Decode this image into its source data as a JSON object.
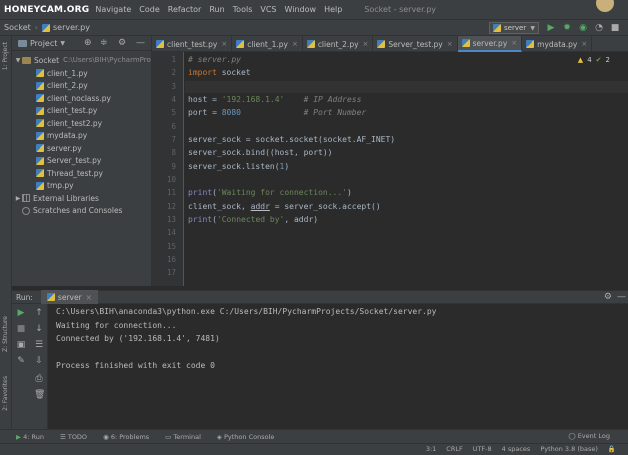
{
  "watermark": "HONEYCAM.ORG",
  "menu": [
    "Navigate",
    "Code",
    "Refactor",
    "Run",
    "Tools",
    "VCS",
    "Window",
    "Help"
  ],
  "window_title": "Socket - server.py",
  "breadcrumb": {
    "project": "Socket",
    "file": "server.py"
  },
  "run_config": {
    "name": "server"
  },
  "left_strip": {
    "project_label": "1: Project",
    "structure_label": "Z: Structure",
    "favorites_label": "2: Favorites"
  },
  "project_panel": {
    "title": "Project",
    "root": {
      "name": "Socket",
      "path": "C:\\Users\\BIH\\PycharmPro"
    },
    "files": [
      "client_1.py",
      "client_2.py",
      "client_noclass.py",
      "client_test.py",
      "client_test2.py",
      "mydata.py",
      "server.py",
      "Server_test.py",
      "Thread_test.py",
      "tmp.py"
    ],
    "external_libraries": "External Libraries",
    "scratches": "Scratches and Consoles"
  },
  "tabs": [
    {
      "label": "client_test.py",
      "active": false
    },
    {
      "label": "client_1.py",
      "active": false
    },
    {
      "label": "client_2.py",
      "active": false
    },
    {
      "label": "Server_test.py",
      "active": false
    },
    {
      "label": "server.py",
      "active": true
    },
    {
      "label": "mydata.py",
      "active": false
    }
  ],
  "editor": {
    "inspections": {
      "warnings": "4",
      "weak_warnings": "2"
    },
    "line_numbers": [
      "1",
      "2",
      "3",
      "4",
      "5",
      "6",
      "7",
      "8",
      "9",
      "10",
      "11",
      "12",
      "13",
      "14",
      "15",
      "16",
      "17"
    ],
    "code": {
      "l1": "# server.py",
      "l2_kw": "import",
      "l2_rest": " socket",
      "l4_a": "host = ",
      "l4_str": "'192.168.1.4'",
      "l4_com": "    # IP Address",
      "l5_a": "port = ",
      "l5_num": "8080",
      "l5_com": "             # Port Number",
      "l7": "server_sock = socket.socket(socket.AF_INET)",
      "l8": "server_sock.bind((host, port))",
      "l9_a": "server_sock.listen(",
      "l9_num": "1",
      "l9_b": ")",
      "l11_fn": "print",
      "l11_a": "(",
      "l11_str": "'Waiting for connection...'",
      "l11_b": ")",
      "l12_a": "client_sock, ",
      "l12_ul": "addr",
      "l12_b": " = server_sock.accept()",
      "l13_fn": "print",
      "l13_a": "(",
      "l13_str": "'Connected by'",
      "l13_b": ", addr)"
    }
  },
  "run_panel": {
    "label": "Run:",
    "tab": "server",
    "console": [
      "C:\\Users\\BIH\\anaconda3\\python.exe C:/Users/BIH/PycharmProjects/Socket/server.py",
      "Waiting for connection...",
      "Connected by ('192.168.1.4', 7481)",
      "",
      "Process finished with exit code 0"
    ]
  },
  "bottom_tools": [
    "4: Run",
    "TODO",
    "6: Problems",
    "Terminal",
    "Python Console"
  ],
  "event_log": "Event Log",
  "status": [
    "3:1",
    "CRLF",
    "UTF-8",
    "4 spaces",
    "Python 3.8 (base)"
  ]
}
